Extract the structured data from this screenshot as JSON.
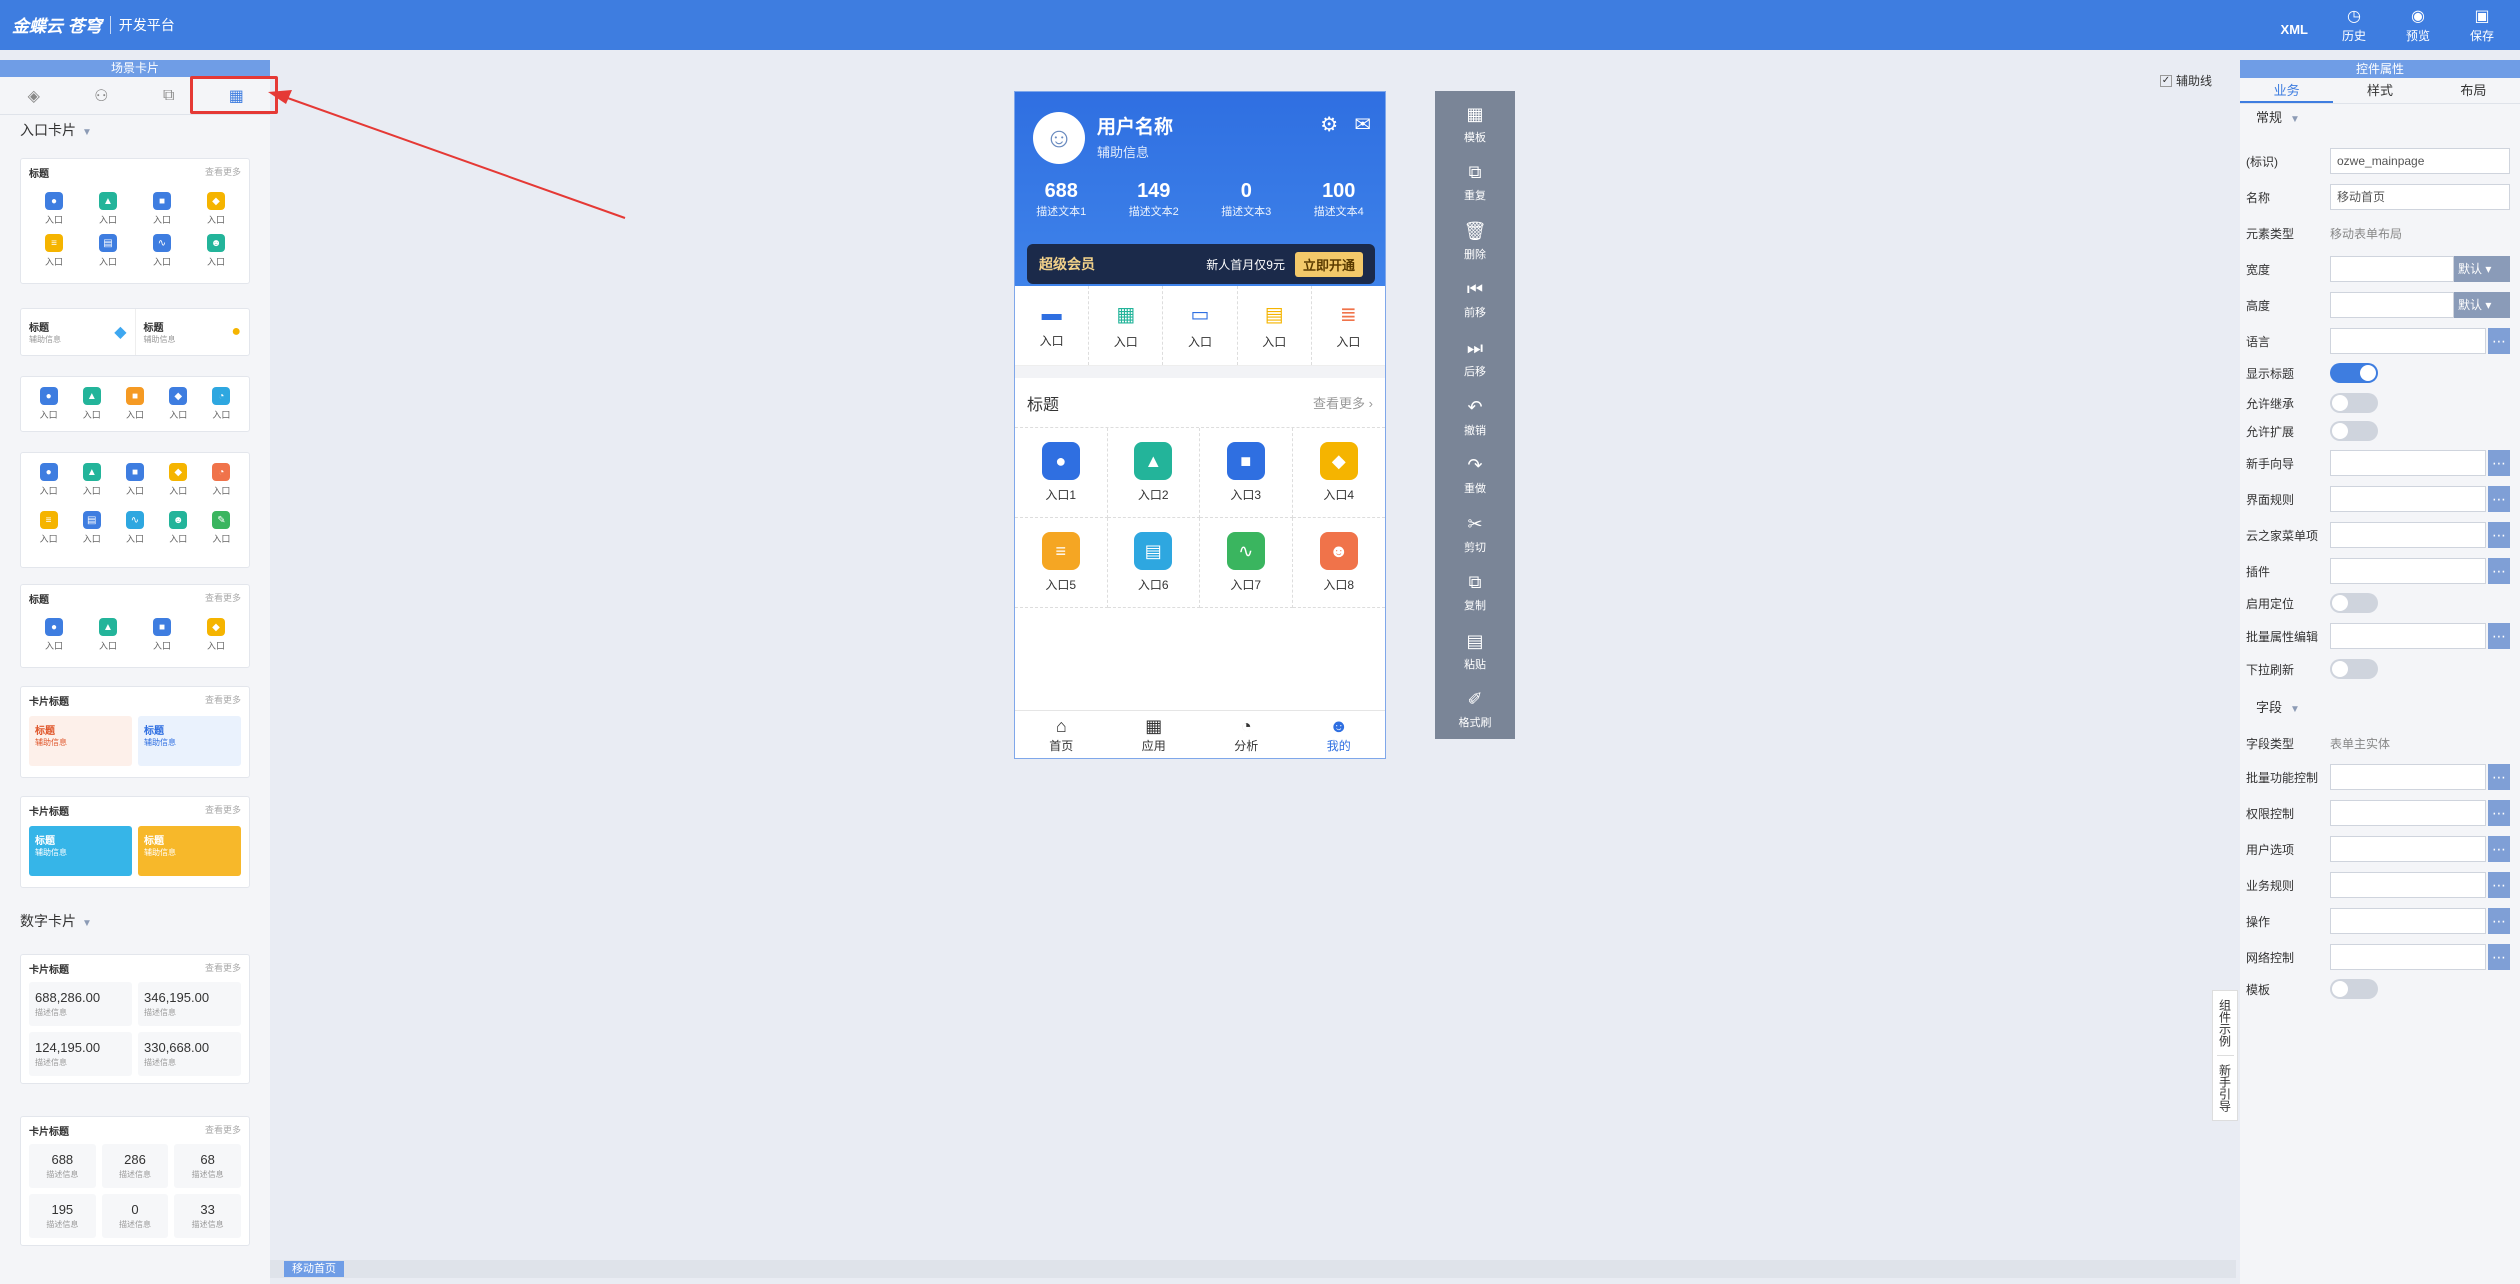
{
  "app": {
    "brand": "金蝶云 苍穹",
    "platform": "开发平台"
  },
  "top_actions": [
    {
      "label": "XML",
      "icon": "xml-text"
    },
    {
      "label": "历史",
      "icon": "clock-icon"
    },
    {
      "label": "预览",
      "icon": "eye-icon"
    },
    {
      "label": "保存",
      "icon": "save-icon"
    }
  ],
  "left_panel": {
    "title": "场景卡片",
    "tabs": [
      {
        "icon": "layers-icon"
      },
      {
        "icon": "org-icon"
      },
      {
        "icon": "copy-icon"
      },
      {
        "icon": "cards-icon"
      }
    ],
    "section1": "入口卡片",
    "section2": "数字卡片",
    "card1": {
      "title": "标题",
      "more": "查看更多",
      "items": [
        "入口",
        "入口",
        "入口",
        "入口",
        "入口",
        "入口",
        "入口",
        "入口"
      ]
    },
    "card2": {
      "a_title": "标题",
      "a_sub": "辅助信息",
      "b_title": "标题",
      "b_sub": "辅助信息"
    },
    "card3": {
      "items": [
        "入口",
        "入口",
        "入口",
        "入口",
        "入口"
      ]
    },
    "card4": {
      "items": [
        "入口",
        "入口",
        "入口",
        "入口",
        "入口",
        "入口",
        "入口",
        "入口",
        "入口",
        "入口"
      ]
    },
    "card5": {
      "title": "标题",
      "more": "查看更多",
      "items": [
        "入口",
        "入口",
        "入口",
        "入口"
      ]
    },
    "card6": {
      "title": "卡片标题",
      "more": "查看更多",
      "a_title": "标题",
      "a_sub": "辅助信息",
      "b_title": "标题",
      "b_sub": "辅助信息"
    },
    "card7": {
      "title": "卡片标题",
      "more": "查看更多",
      "a_title": "标题",
      "a_sub": "辅助信息",
      "b_title": "标题",
      "b_sub": "辅助信息"
    },
    "card8": {
      "title": "卡片标题",
      "more": "查看更多",
      "nums": [
        {
          "v": "688,286.00",
          "s": "描述信息"
        },
        {
          "v": "346,195.00",
          "s": "描述信息"
        },
        {
          "v": "124,195.00",
          "s": "描述信息"
        },
        {
          "v": "330,668.00",
          "s": "描述信息"
        }
      ]
    },
    "card9": {
      "title": "卡片标题",
      "more": "查看更多",
      "nums": [
        {
          "v": "688",
          "s": "描述信息"
        },
        {
          "v": "286",
          "s": "描述信息"
        },
        {
          "v": "68",
          "s": "描述信息"
        },
        {
          "v": "195",
          "s": "描述信息"
        },
        {
          "v": "0",
          "s": "描述信息"
        },
        {
          "v": "33",
          "s": "描述信息"
        }
      ]
    }
  },
  "phone": {
    "user_name": "用户名称",
    "user_sub": "辅助信息",
    "stats": [
      {
        "v": "688",
        "l": "描述文本1"
      },
      {
        "v": "149",
        "l": "描述文本2"
      },
      {
        "v": "0",
        "l": "描述文本3"
      },
      {
        "v": "100",
        "l": "描述文本4"
      }
    ],
    "vip": {
      "title": "超级会员",
      "desc": "新人首月仅9元",
      "btn": "立即开通"
    },
    "quick": [
      "入口",
      "入口",
      "入口",
      "入口",
      "入口"
    ],
    "section_title": "标题",
    "section_more": "查看更多",
    "grid": [
      "入口1",
      "入口2",
      "入口3",
      "入口4",
      "入口5",
      "入口6",
      "入口7",
      "入口8"
    ],
    "tabbar": [
      "首页",
      "应用",
      "分析",
      "我的"
    ]
  },
  "toolbar": [
    "模板",
    "重复",
    "删除",
    "前移",
    "后移",
    "撤销",
    "重做",
    "剪切",
    "复制",
    "粘贴",
    "格式刷"
  ],
  "helpline": "辅助线",
  "right_panel": {
    "title": "控件属性",
    "tabs": [
      "业务",
      "样式",
      "布局"
    ],
    "group1": "常规",
    "group2": "字段",
    "labels": {
      "key": "(标识)",
      "name": "名称",
      "etype": "元素类型",
      "width": "宽度",
      "height": "高度",
      "lang": "语言",
      "show_title": "显示标题",
      "inherit": "允许继承",
      "extend": "允许扩展",
      "guide": "新手向导",
      "ui_rule": "界面规则",
      "cloud_menu": "云之家菜单项",
      "plugin": "插件",
      "locate": "启用定位",
      "batch_edit": "批量属性编辑",
      "pull": "下拉刷新",
      "ftype": "字段类型",
      "batch_ctrl": "批量功能控制",
      "perm": "权限控制",
      "user_opt": "用户选项",
      "biz_rule": "业务规则",
      "op": "操作",
      "net": "网络控制",
      "tpl": "模板"
    },
    "values": {
      "key": "ozwe_mainpage",
      "name": "移动首页",
      "etype": "移动表单布局",
      "width_sel": "默认",
      "height_sel": "默认",
      "ftype": "表单主实体"
    }
  },
  "side_tabs": [
    "组件示例",
    "新手引导"
  ],
  "bottom_tag": "移动首页"
}
